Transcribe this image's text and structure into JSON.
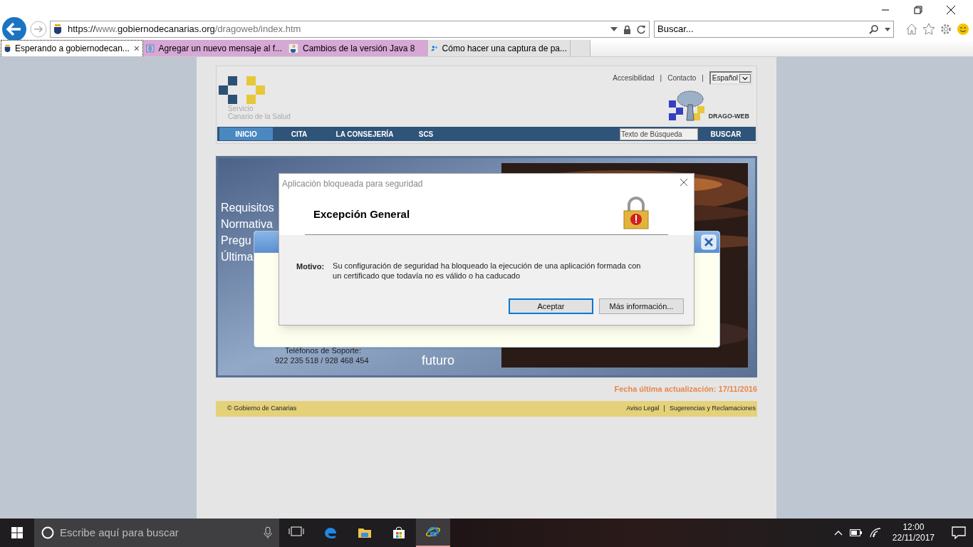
{
  "browser": {
    "address": {
      "parts": [
        {
          "text": "https://",
          "strong": true
        },
        {
          "text": "www.",
          "strong": false
        },
        {
          "text": "gobiernodecanarias.org",
          "strong": true
        },
        {
          "text": "/dragoweb/index.htm",
          "strong": false
        }
      ]
    },
    "search": {
      "placeholder": "Buscar..."
    },
    "tabs": [
      {
        "label": "Esperando a gobiernodecan...",
        "selected": true,
        "color": "#ffffff",
        "close": "×"
      },
      {
        "label": "Agregar un nuevo mensaje al f...",
        "selected": false,
        "color": "#d7a8d6"
      },
      {
        "label": "Cambios de la versión Java 8",
        "selected": false,
        "color": "#d7a8d6"
      },
      {
        "label": "Cómo hacer una captura de pa...",
        "selected": false,
        "color": "#e2e2e2"
      }
    ]
  },
  "site": {
    "logo_text": [
      "Servicio",
      "Canario de la Salud"
    ],
    "top_links": [
      "Accesibilidad",
      "Contacto"
    ],
    "top_separators": [
      "|",
      "|"
    ],
    "language": "Español",
    "brand": "DRAGO-WEB",
    "nav": [
      {
        "label": "INICIO",
        "selected": true
      },
      {
        "label": "CITA",
        "selected": false
      },
      {
        "label": "LA CONSEJERÍA",
        "selected": false
      },
      {
        "label": "SCS",
        "selected": false
      }
    ],
    "search": {
      "value": "Texto de Búsqueda",
      "button": "BUSCAR"
    },
    "banner": {
      "links": [
        "Requisitos",
        "Normativa",
        "Pregu",
        "Última"
      ],
      "phone_label": "Teléfonos de Soporte:",
      "phone": "922 235 518 / 928 468 454",
      "slogan_end": "futuro"
    },
    "updated": "Fecha última actualización: 17/11/2016",
    "footer": {
      "copyright": "© Gobierno de Canarias",
      "links": [
        "Aviso Legal",
        "Sugerencias y Reclamaciones"
      ],
      "separators": [
        "|"
      ]
    }
  },
  "dialog": {
    "title": "Aplicación bloqueada para seguridad",
    "heading": "Excepción General",
    "reason_label": "Motivo:",
    "reason": "Su configuración de seguridad ha bloqueado la ejecución de una aplicación formada con un certificado que todavía no es válido o ha caducado",
    "buttons": [
      {
        "label": "Aceptar",
        "focused": true
      },
      {
        "label": "Más información...",
        "focused": false
      }
    ]
  },
  "taskbar": {
    "search": {
      "placeholder": "Escribe aquí para buscar"
    },
    "apps": [
      {
        "kind": "taskview",
        "active": false
      },
      {
        "kind": "edge",
        "active": false
      },
      {
        "kind": "explorer",
        "active": false
      },
      {
        "kind": "store",
        "active": false
      },
      {
        "kind": "ie",
        "active": true
      }
    ],
    "time": "12:00",
    "date": "22/11/2017"
  }
}
